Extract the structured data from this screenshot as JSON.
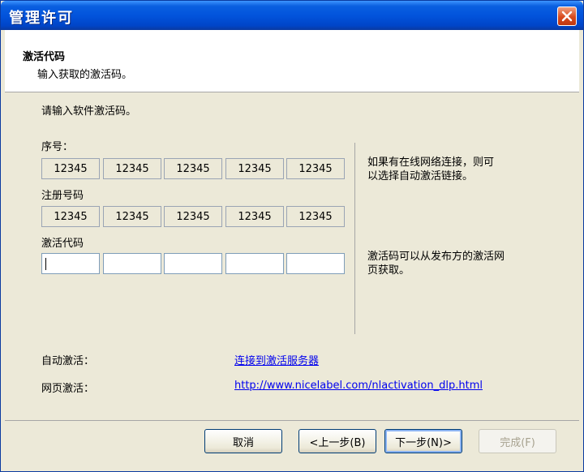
{
  "window": {
    "title": "管理许可"
  },
  "header": {
    "title": "激活代码",
    "subtitle": "输入获取的激活码。"
  },
  "form": {
    "prompt": "请输入软件激活码。",
    "serial_label": "序号：",
    "serial_values": [
      "12345",
      "12345",
      "12345",
      "12345",
      "12345"
    ],
    "reg_label": "注册号码",
    "reg_values": [
      "12345",
      "12345",
      "12345",
      "12345",
      "12345"
    ],
    "activation_label": "激活代码",
    "activation_values": [
      "",
      "",
      "",
      "",
      ""
    ]
  },
  "notes": {
    "online_line1": "如果有在线网络连接，则可",
    "online_line2": "以选择自动激活链接。",
    "web_line1": "激活码可以从发布方的激活网",
    "web_line2": "页获取。"
  },
  "links": {
    "auto_label": "自动激活：",
    "auto_link": "连接到激活服务器",
    "web_label": "网页激活：",
    "web_link": "http://www.nicelabel.com/nlactivation_dlp.html"
  },
  "buttons": {
    "cancel": "取消",
    "back": "<上一步(B)",
    "next": "下一步(N)>",
    "finish": "完成(F)"
  }
}
